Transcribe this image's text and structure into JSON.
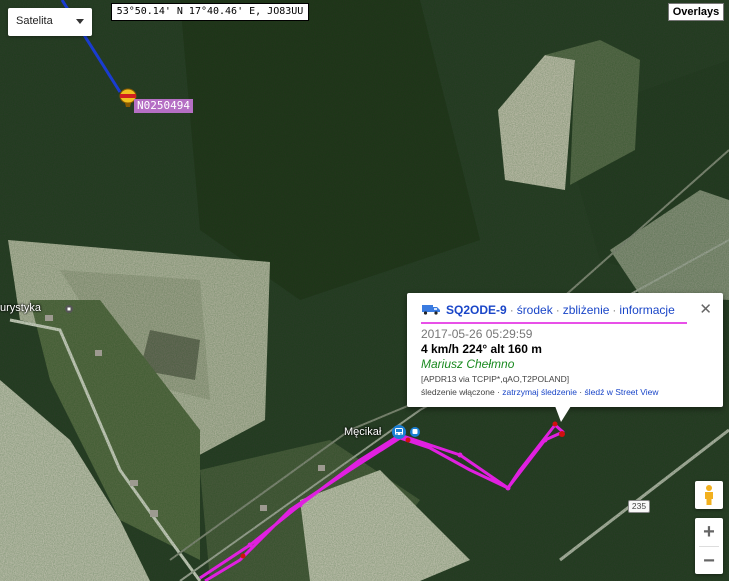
{
  "map_type": {
    "selected": "Satelita"
  },
  "coords_readout": "53°50.14' N 17°40.46' E, JO83UU",
  "overlays_button": "Overlays",
  "station_label": "N0250494",
  "place_labels": {
    "turystyka": "urystyka",
    "mecikal": "Męcikał"
  },
  "road_number": "235",
  "popup": {
    "callsign": "SQ2ODE-9",
    "links": [
      "środek",
      "zbliżenie",
      "informacje"
    ],
    "timestamp": "2017-05-26 05:29:59",
    "speed_line": "4 km/h 224° alt 160 m",
    "comment": "Mariusz Chełmno",
    "path": "[APDR13 via TCPIP*,qAO,T2POLAND]",
    "tracking_prefix": "śledzenie włączone ·",
    "tracking_links": [
      "zatrzymaj śledzenie",
      "śledź w Street View"
    ]
  },
  "zoom": {
    "in": "+",
    "out": "−"
  },
  "colors": {
    "track": "#e020e0",
    "blue_path": "#1a3cd0",
    "link": "#1a46c8",
    "comment": "#1a8a20"
  },
  "icons": [
    "chevron-down-icon",
    "van-icon",
    "close-icon",
    "pegman-icon",
    "train-icon",
    "bus-icon",
    "balloon-icon"
  ]
}
